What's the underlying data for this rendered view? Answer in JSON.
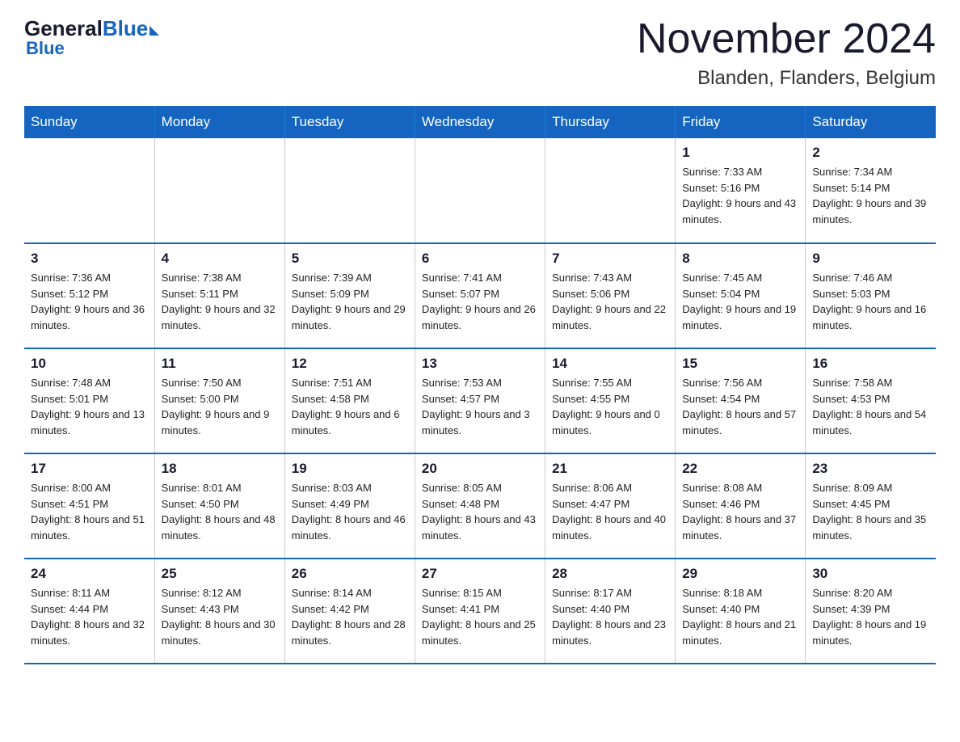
{
  "logo": {
    "text_general": "General",
    "text_blue": "Blue",
    "arrow_label": "logo-arrow"
  },
  "header": {
    "month_title": "November 2024",
    "location": "Blanden, Flanders, Belgium"
  },
  "weekdays": [
    "Sunday",
    "Monday",
    "Tuesday",
    "Wednesday",
    "Thursday",
    "Friday",
    "Saturday"
  ],
  "weeks": [
    [
      {
        "day": "",
        "info": ""
      },
      {
        "day": "",
        "info": ""
      },
      {
        "day": "",
        "info": ""
      },
      {
        "day": "",
        "info": ""
      },
      {
        "day": "",
        "info": ""
      },
      {
        "day": "1",
        "info": "Sunrise: 7:33 AM\nSunset: 5:16 PM\nDaylight: 9 hours and 43 minutes."
      },
      {
        "day": "2",
        "info": "Sunrise: 7:34 AM\nSunset: 5:14 PM\nDaylight: 9 hours and 39 minutes."
      }
    ],
    [
      {
        "day": "3",
        "info": "Sunrise: 7:36 AM\nSunset: 5:12 PM\nDaylight: 9 hours and 36 minutes."
      },
      {
        "day": "4",
        "info": "Sunrise: 7:38 AM\nSunset: 5:11 PM\nDaylight: 9 hours and 32 minutes."
      },
      {
        "day": "5",
        "info": "Sunrise: 7:39 AM\nSunset: 5:09 PM\nDaylight: 9 hours and 29 minutes."
      },
      {
        "day": "6",
        "info": "Sunrise: 7:41 AM\nSunset: 5:07 PM\nDaylight: 9 hours and 26 minutes."
      },
      {
        "day": "7",
        "info": "Sunrise: 7:43 AM\nSunset: 5:06 PM\nDaylight: 9 hours and 22 minutes."
      },
      {
        "day": "8",
        "info": "Sunrise: 7:45 AM\nSunset: 5:04 PM\nDaylight: 9 hours and 19 minutes."
      },
      {
        "day": "9",
        "info": "Sunrise: 7:46 AM\nSunset: 5:03 PM\nDaylight: 9 hours and 16 minutes."
      }
    ],
    [
      {
        "day": "10",
        "info": "Sunrise: 7:48 AM\nSunset: 5:01 PM\nDaylight: 9 hours and 13 minutes."
      },
      {
        "day": "11",
        "info": "Sunrise: 7:50 AM\nSunset: 5:00 PM\nDaylight: 9 hours and 9 minutes."
      },
      {
        "day": "12",
        "info": "Sunrise: 7:51 AM\nSunset: 4:58 PM\nDaylight: 9 hours and 6 minutes."
      },
      {
        "day": "13",
        "info": "Sunrise: 7:53 AM\nSunset: 4:57 PM\nDaylight: 9 hours and 3 minutes."
      },
      {
        "day": "14",
        "info": "Sunrise: 7:55 AM\nSunset: 4:55 PM\nDaylight: 9 hours and 0 minutes."
      },
      {
        "day": "15",
        "info": "Sunrise: 7:56 AM\nSunset: 4:54 PM\nDaylight: 8 hours and 57 minutes."
      },
      {
        "day": "16",
        "info": "Sunrise: 7:58 AM\nSunset: 4:53 PM\nDaylight: 8 hours and 54 minutes."
      }
    ],
    [
      {
        "day": "17",
        "info": "Sunrise: 8:00 AM\nSunset: 4:51 PM\nDaylight: 8 hours and 51 minutes."
      },
      {
        "day": "18",
        "info": "Sunrise: 8:01 AM\nSunset: 4:50 PM\nDaylight: 8 hours and 48 minutes."
      },
      {
        "day": "19",
        "info": "Sunrise: 8:03 AM\nSunset: 4:49 PM\nDaylight: 8 hours and 46 minutes."
      },
      {
        "day": "20",
        "info": "Sunrise: 8:05 AM\nSunset: 4:48 PM\nDaylight: 8 hours and 43 minutes."
      },
      {
        "day": "21",
        "info": "Sunrise: 8:06 AM\nSunset: 4:47 PM\nDaylight: 8 hours and 40 minutes."
      },
      {
        "day": "22",
        "info": "Sunrise: 8:08 AM\nSunset: 4:46 PM\nDaylight: 8 hours and 37 minutes."
      },
      {
        "day": "23",
        "info": "Sunrise: 8:09 AM\nSunset: 4:45 PM\nDaylight: 8 hours and 35 minutes."
      }
    ],
    [
      {
        "day": "24",
        "info": "Sunrise: 8:11 AM\nSunset: 4:44 PM\nDaylight: 8 hours and 32 minutes."
      },
      {
        "day": "25",
        "info": "Sunrise: 8:12 AM\nSunset: 4:43 PM\nDaylight: 8 hours and 30 minutes."
      },
      {
        "day": "26",
        "info": "Sunrise: 8:14 AM\nSunset: 4:42 PM\nDaylight: 8 hours and 28 minutes."
      },
      {
        "day": "27",
        "info": "Sunrise: 8:15 AM\nSunset: 4:41 PM\nDaylight: 8 hours and 25 minutes."
      },
      {
        "day": "28",
        "info": "Sunrise: 8:17 AM\nSunset: 4:40 PM\nDaylight: 8 hours and 23 minutes."
      },
      {
        "day": "29",
        "info": "Sunrise: 8:18 AM\nSunset: 4:40 PM\nDaylight: 8 hours and 21 minutes."
      },
      {
        "day": "30",
        "info": "Sunrise: 8:20 AM\nSunset: 4:39 PM\nDaylight: 8 hours and 19 minutes."
      }
    ]
  ]
}
